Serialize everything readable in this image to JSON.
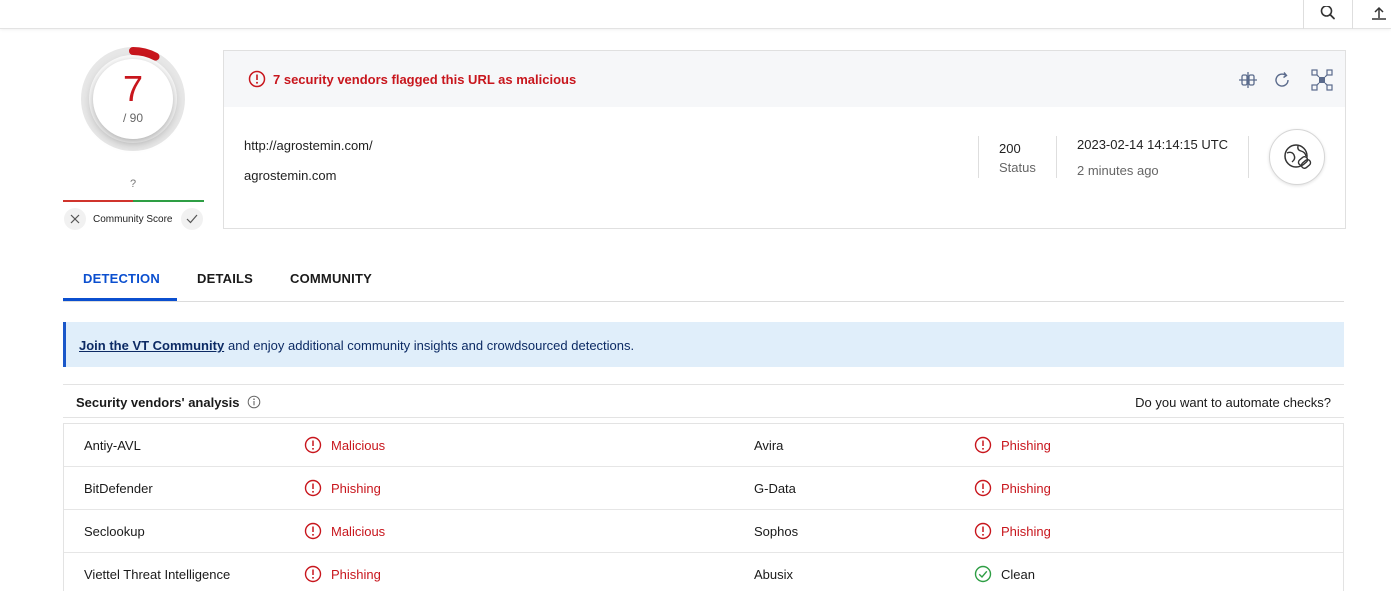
{
  "score": {
    "detections": "7",
    "total": "/ 90",
    "community_unknown": "?",
    "community_label": "Community Score"
  },
  "summary": {
    "alert": "7 security vendors flagged this URL as malicious",
    "url": "http://agrostemin.com/",
    "domain": "agrostemin.com",
    "status_code": "200",
    "status_label": "Status",
    "timestamp": "2023-02-14 14:14:15 UTC",
    "ago": "2 minutes ago"
  },
  "tabs": [
    {
      "label": "DETECTION",
      "active": true
    },
    {
      "label": "DETAILS",
      "active": false
    },
    {
      "label": "COMMUNITY",
      "active": false
    }
  ],
  "banner": {
    "link": "Join the VT Community",
    "text": "and enjoy additional community insights and crowdsourced detections."
  },
  "vendors_header": {
    "title": "Security vendors' analysis",
    "automate": "Do you want to automate checks?"
  },
  "vendors": [
    {
      "left": {
        "name": "Antiy-AVL",
        "result": "Malicious"
      },
      "right": {
        "name": "Avira",
        "result": "Phishing"
      }
    },
    {
      "left": {
        "name": "BitDefender",
        "result": "Phishing"
      },
      "right": {
        "name": "G-Data",
        "result": "Phishing"
      }
    },
    {
      "left": {
        "name": "Seclookup",
        "result": "Malicious"
      },
      "right": {
        "name": "Sophos",
        "result": "Phishing"
      }
    },
    {
      "left": {
        "name": "Viettel Threat Intelligence",
        "result": "Phishing"
      },
      "right": {
        "name": "Abusix",
        "result": "Clean"
      }
    }
  ],
  "colors": {
    "malicious": "#c8161d",
    "clean": "#2e9e44",
    "accent": "#0b4fcf",
    "banner_bg": "#e0eefa"
  },
  "icons": [
    "search-icon",
    "upload-icon",
    "alert-circle-icon",
    "compare-icon",
    "reanalyze-icon",
    "graph-icon",
    "url-link-icon",
    "info-icon",
    "close-icon",
    "check-icon",
    "check-circle-icon"
  ]
}
